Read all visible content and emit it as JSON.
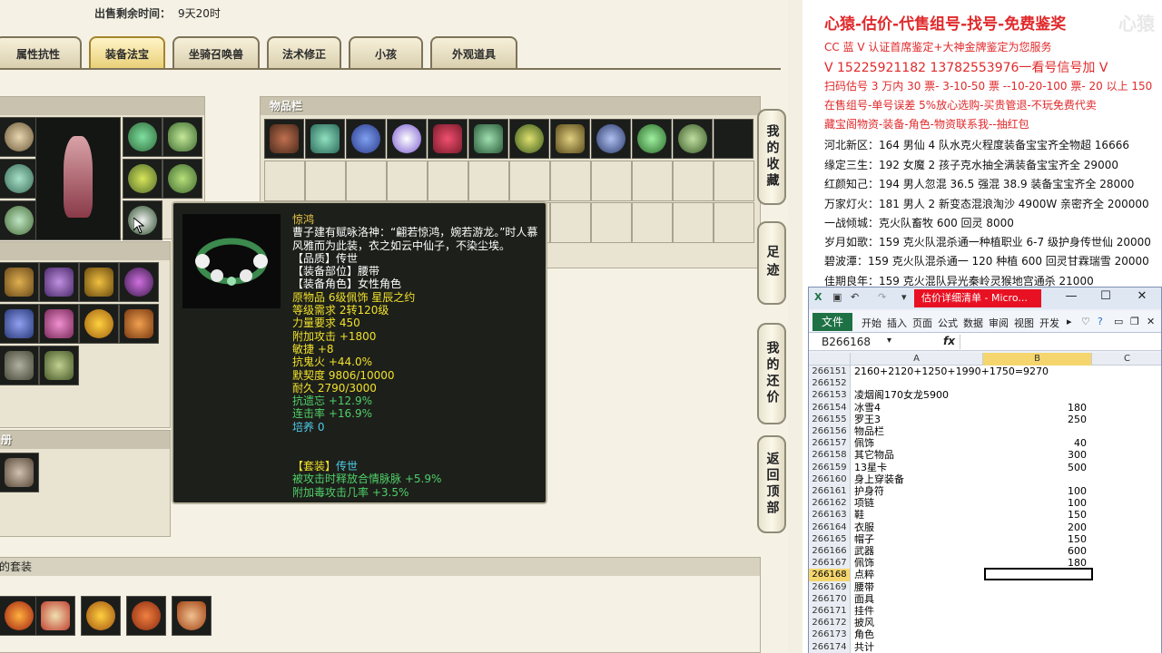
{
  "game": {
    "sale_time_label": "出售剩余时间：",
    "sale_time_value": "9天20时",
    "tabs": [
      "属性抗性",
      "装备法宝",
      "坐骑召唤兽",
      "法术修正",
      "小孩",
      "外观道具"
    ],
    "active_tab": "装备法宝",
    "inventory_title": "物品栏",
    "bottom_title_fragment": "册",
    "set_title": "的套装",
    "side_buttons": [
      "我的收藏",
      "足迹",
      "我的还价",
      "返回顶部"
    ],
    "tooltip": {
      "name": "惊鸿",
      "desc": "曹子建有赋咏洛神：“翩若惊鸿，婉若游龙。”时人慕风雅而为此装，衣之如云中仙子，不染尘埃。",
      "lines_white": [
        "【品质】传世",
        "【装备部位】腰带",
        "【装备角色】女性角色"
      ],
      "lines_yellow": [
        "原物品 6级佩饰 星辰之约",
        "等级需求 2转120级",
        "力量要求 450",
        "附加攻击 +1800",
        "敏捷 +8",
        "抗鬼火 +44.0%",
        "默契度 9806/10000",
        "耐久 2790/3000"
      ],
      "lines_green": [
        "抗遗忘 +12.9%",
        "连击率 +16.9%"
      ],
      "line_cyan": "培养 0",
      "set_label": "【套装】",
      "set_name": "传世",
      "set_effects": [
        "被攻击时释放合情脉脉 +5.9%",
        "附加毒攻击几率 +3.5%"
      ]
    }
  },
  "overlay": {
    "title": "心猿-估价-代售组号-找号-免费鉴奖",
    "watermark": "心猿",
    "lines_red": [
      "CC 蓝 V 认证首席鉴定+大神金牌鉴定为您服务",
      "V 15225921182      13782553976一看号信号加 V",
      "扫码估号 3 万内 30 票- 3-10-50 票  --10-20-100 票- 20 以上 150",
      "在售组号-单号误差 5%放心选购-买贵管退-不玩免费代卖",
      "藏宝阁物资-装备-角色-物资联系我--抽红包"
    ],
    "lines_black": [
      "河北新区：164 男仙 4 队水克火程度装备宝宝齐全物超 16666",
      "缘定三生：192 女魔 2 孩子克水抽全满装备宝宝齐全 29000",
      "红颜知己：194 男人忽混 36.5 强混 38.9 装备宝宝齐全 28000",
      "万家灯火：181 男人 2 新变态混浪淘沙 4900W 亲密齐全 200000",
      "一战倾城：克火队畜牧 600 回灵 8000",
      "岁月如歌：159 克火队混杀通一种植职业 6-7 级护身传世仙 20000",
      "碧波潭：159 克火队混杀通一 120 种植 600 回灵甘霖瑞雪 20000",
      "佳期良年：159 克火混队异光秦岭灵猴地宫通杀 21000"
    ]
  },
  "excel": {
    "title": "估价详细清单 - Micro...",
    "file_tab": "文件",
    "ribbon_tabs": [
      "开始",
      "插入",
      "页面",
      "公式",
      "数据",
      "审阅",
      "视图",
      "开发"
    ],
    "name_box": "B266168",
    "fx": "fx",
    "columns": [
      "A",
      "B",
      "C"
    ],
    "rows": [
      {
        "n": "266151",
        "a": "2160+2120+1250+1990+1750=9270",
        "b": ""
      },
      {
        "n": "266152",
        "a": "",
        "b": ""
      },
      {
        "n": "266153",
        "a": "凌烟阁170女龙5900",
        "b": ""
      },
      {
        "n": "266154",
        "a": "冰雪4",
        "b": "180"
      },
      {
        "n": "266155",
        "a": "罗王3",
        "b": "250"
      },
      {
        "n": "266156",
        "a": "物品栏",
        "b": ""
      },
      {
        "n": "266157",
        "a": "佩饰",
        "b": "40"
      },
      {
        "n": "266158",
        "a": "其它物品",
        "b": "300"
      },
      {
        "n": "266159",
        "a": "13星卡",
        "b": "500"
      },
      {
        "n": "266160",
        "a": "身上穿装备",
        "b": ""
      },
      {
        "n": "266161",
        "a": "护身符",
        "b": "100"
      },
      {
        "n": "266162",
        "a": "项链",
        "b": "100"
      },
      {
        "n": "266163",
        "a": "鞋",
        "b": "150"
      },
      {
        "n": "266164",
        "a": "衣服",
        "b": "200"
      },
      {
        "n": "266165",
        "a": "帽子",
        "b": "150"
      },
      {
        "n": "266166",
        "a": "武器",
        "b": "600"
      },
      {
        "n": "266167",
        "a": "佩饰",
        "b": "180"
      },
      {
        "n": "266168",
        "a": "点粹",
        "b": ""
      },
      {
        "n": "266169",
        "a": "腰带",
        "b": ""
      },
      {
        "n": "266170",
        "a": "面具",
        "b": ""
      },
      {
        "n": "266171",
        "a": "挂件",
        "b": ""
      },
      {
        "n": "266172",
        "a": "披风",
        "b": ""
      },
      {
        "n": "266173",
        "a": "角色",
        "b": ""
      },
      {
        "n": "266174",
        "a": "共计",
        "b": ""
      }
    ],
    "selected_row": "266168"
  },
  "colors": {
    "red_text": "#e0292b",
    "tooltip_bg": "#1d1f1a",
    "gold": "#e8c64a",
    "excel_green": "#1e7145"
  }
}
